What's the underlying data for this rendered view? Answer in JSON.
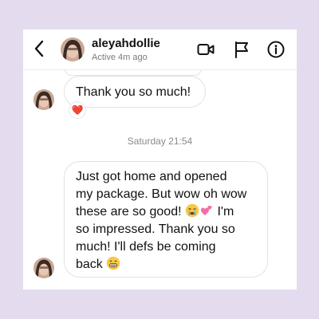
{
  "header": {
    "username": "aleyahdollie",
    "status": "Active 4m ago",
    "icons": [
      "back-arrow-icon",
      "video-call-icon",
      "flag-icon",
      "info-icon"
    ]
  },
  "messages": [
    {
      "text": "Thank you so much!",
      "reaction": "❤️"
    },
    {
      "timestamp": "Saturday 21:54"
    },
    {
      "lines": [
        "Just got home and opened",
        "my package. But wow oh wow",
        "these are so good!",
        "I'm",
        "so impressed. Thank you so",
        "much! I'll defs be coming",
        "back"
      ],
      "emojis": [
        "crying-face",
        "two-hearts",
        "grinning-face"
      ]
    }
  ],
  "colors": {
    "background": "#e4dcee",
    "card": "#ffffff",
    "bubble_border": "#e2e2e2",
    "secondary_text": "#7a7a7a",
    "reaction_heart": "#e0245e"
  }
}
